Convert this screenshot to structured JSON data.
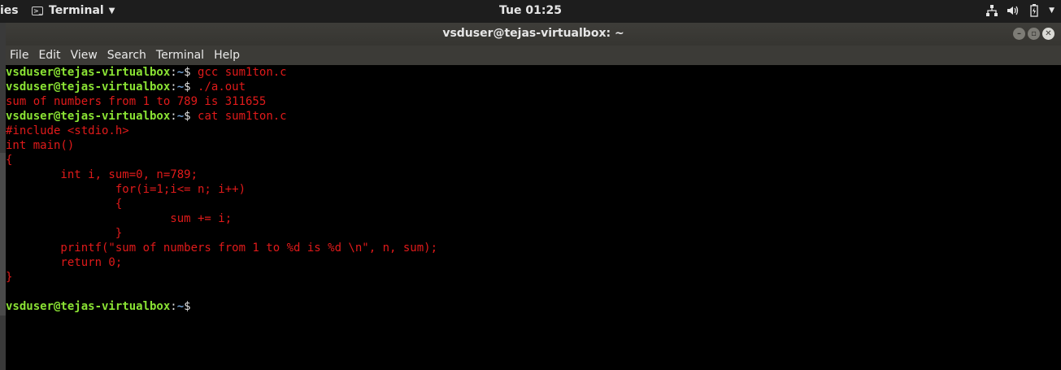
{
  "top_panel": {
    "activities": "ies",
    "app_menu": "Terminal",
    "clock": "Tue 01:25"
  },
  "window": {
    "title": "vsduser@tejas-virtualbox: ~",
    "menu": [
      "File",
      "Edit",
      "View",
      "Search",
      "Terminal",
      "Help"
    ]
  },
  "terminal": {
    "prompt_user": "vsduser@tejas-virtualbox",
    "prompt_path": "~",
    "lines": [
      {
        "type": "prompt",
        "cmd": " gcc sum1ton.c"
      },
      {
        "type": "prompt",
        "cmd": " ./a.out"
      },
      {
        "type": "out",
        "text": "sum of numbers from 1 to 789 is 311655"
      },
      {
        "type": "prompt",
        "cmd": " cat sum1ton.c"
      },
      {
        "type": "out",
        "text": "#include <stdio.h>"
      },
      {
        "type": "out",
        "text": "int main()"
      },
      {
        "type": "out",
        "text": "{"
      },
      {
        "type": "out",
        "text": "        int i, sum=0, n=789;"
      },
      {
        "type": "out",
        "text": "                for(i=1;i<= n; i++)"
      },
      {
        "type": "out",
        "text": "                {"
      },
      {
        "type": "out",
        "text": "                        sum += i;"
      },
      {
        "type": "out",
        "text": "                }"
      },
      {
        "type": "out",
        "text": "        printf(\"sum of numbers from 1 to %d is %d \\n\", n, sum);"
      },
      {
        "type": "out",
        "text": "        return 0;"
      },
      {
        "type": "out",
        "text": "}"
      },
      {
        "type": "out",
        "text": ""
      },
      {
        "type": "prompt",
        "cmd": ""
      }
    ]
  }
}
